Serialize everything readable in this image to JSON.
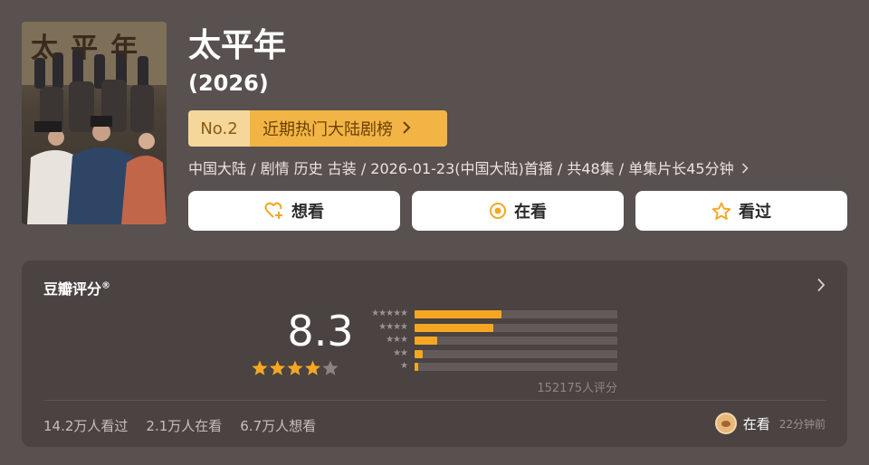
{
  "poster": {
    "title_text": "太平年"
  },
  "title": "太平年",
  "year": "(2026)",
  "rank": {
    "no": "No.2",
    "list_name": "近期热门大陆剧榜"
  },
  "meta": "中国大陆 / 剧情 历史 古装 / 2026-01-23(中国大陆)首播 / 共48集 / 单集片长45分钟",
  "actions": [
    {
      "label": "想看",
      "icon": "heart-plus-icon"
    },
    {
      "label": "在看",
      "icon": "target-circle-icon"
    },
    {
      "label": "看过",
      "icon": "star-outline-icon"
    }
  ],
  "rating": {
    "title": "豆瓣评分",
    "registered_mark": "®",
    "score": "8.3",
    "stars_filled": 4,
    "stars_total": 5,
    "distribution": [
      {
        "stars": 5,
        "label": "★★★★★",
        "fraction": 0.43
      },
      {
        "stars": 4,
        "label": "★★★★",
        "fraction": 0.39
      },
      {
        "stars": 3,
        "label": "★★★",
        "fraction": 0.11
      },
      {
        "stars": 2,
        "label": "★★",
        "fraction": 0.04
      },
      {
        "stars": 1,
        "label": "★",
        "fraction": 0.02
      }
    ],
    "vote_count": "152175人评分"
  },
  "stats": {
    "watched": "14.2万人看过",
    "watching": "2.1万人在看",
    "wish": "6.7万人想看"
  },
  "friend": {
    "status": "在看",
    "time": "22分钟前"
  },
  "colors": {
    "background": "#59514f",
    "card": "#4a4341",
    "accent": "#f5a623",
    "rank_bg": "#f2b545"
  }
}
